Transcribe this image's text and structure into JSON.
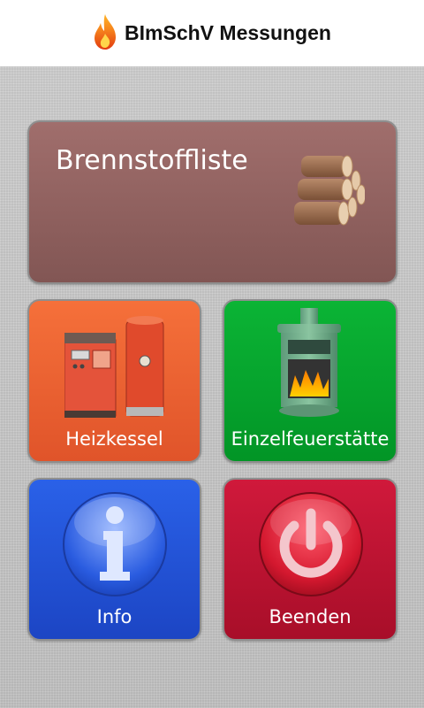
{
  "app": {
    "title": "BImSchV Messungen",
    "logo_icon": "flame-icon"
  },
  "tiles": {
    "fuel_list": {
      "label": "Brennstoffliste",
      "icon": "firewood-icon",
      "color": "#925f5d"
    },
    "boiler": {
      "label": "Heizkessel",
      "icon": "boiler-icon",
      "color": "#ec5f31"
    },
    "stove": {
      "label": "Einzelfeuerstätte",
      "icon": "stove-icon",
      "color": "#06a42e"
    },
    "info": {
      "label": "Info",
      "icon": "info-icon",
      "color": "#2453d6"
    },
    "exit": {
      "label": "Beenden",
      "icon": "power-icon",
      "color": "#bd1332"
    }
  }
}
